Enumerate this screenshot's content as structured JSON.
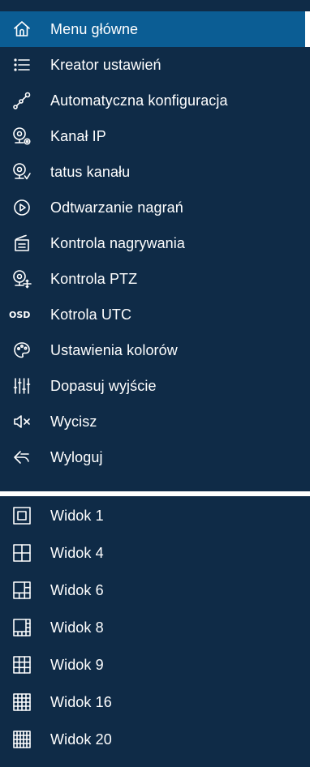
{
  "main_menu": {
    "items": [
      {
        "label": "Menu główne",
        "icon": "home-icon",
        "active": true
      },
      {
        "label": "Kreator ustawień",
        "icon": "list-icon"
      },
      {
        "label": "Automatyczna konfiguracja",
        "icon": "auto-config-icon"
      },
      {
        "label": "Kanał IP",
        "icon": "ip-camera-icon"
      },
      {
        "label": "tatus kanału",
        "icon": "camera-check-icon"
      },
      {
        "label": "Odtwarzanie nagrań",
        "icon": "play-circle-icon"
      },
      {
        "label": "Kontrola nagrywania",
        "icon": "recorder-icon"
      },
      {
        "label": "Kontrola PTZ",
        "icon": "ptz-icon"
      },
      {
        "label": "Kotrola UTC",
        "icon": "osd-icon",
        "icon_text": "OSD"
      },
      {
        "label": "Ustawienia kolorów",
        "icon": "palette-icon"
      },
      {
        "label": "Dopasuj wyjście",
        "icon": "equalizer-icon"
      },
      {
        "label": "Wycisz",
        "icon": "mute-icon"
      },
      {
        "label": "Wyloguj",
        "icon": "logout-icon"
      }
    ]
  },
  "view_menu": {
    "items": [
      {
        "label": "Widok 1",
        "icon": "layout-1-icon"
      },
      {
        "label": "Widok 4",
        "icon": "layout-4-icon"
      },
      {
        "label": "Widok 6",
        "icon": "layout-6-icon"
      },
      {
        "label": "Widok 8",
        "icon": "layout-8-icon"
      },
      {
        "label": "Widok 9",
        "icon": "layout-9-icon"
      },
      {
        "label": "Widok 16",
        "icon": "layout-16-icon"
      },
      {
        "label": "Widok 20",
        "icon": "layout-20-icon"
      }
    ]
  },
  "colors": {
    "panel_bg": "#0f2b47",
    "active_bg": "#0b5d94",
    "text": "#ffffff"
  }
}
